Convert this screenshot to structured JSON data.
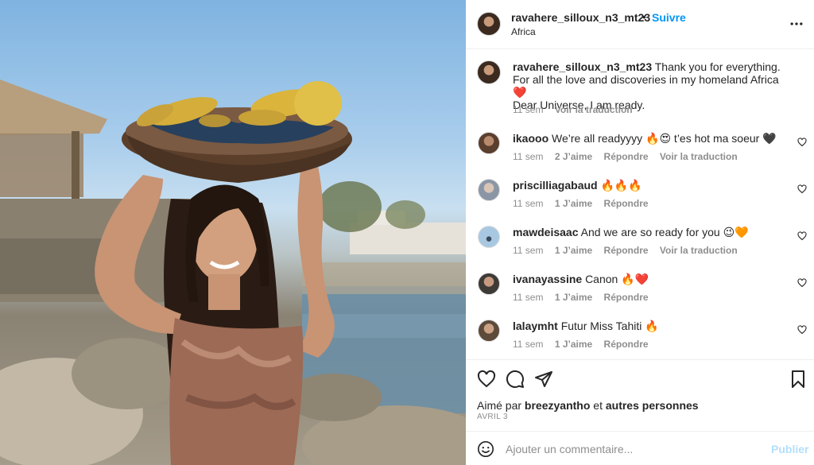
{
  "post": {
    "username": "ravahere_silloux_n3_mt23",
    "separator": "•",
    "follow_label": "Suivre",
    "location": "Africa",
    "more_icon": "more-horizontal-icon"
  },
  "caption": {
    "username": "ravahere_silloux_n3_mt23",
    "line1": "Thank you for everything.",
    "line2": "For all the love and discoveries in my homeland Africa ❤️",
    "line3": "Dear Universe, I am ready.",
    "time": "11 sem",
    "translate": "Voir la traduction"
  },
  "comments": [
    {
      "username": "ikaooo",
      "text": "We’re all readyyyy 🔥😍 t’es hot ma soeur 🖤",
      "time": "11 sem",
      "likes": "2 J’aime",
      "reply": "Répondre",
      "translate": "Voir la traduction"
    },
    {
      "username": "priscilliagabaud",
      "text": "🔥🔥🔥",
      "time": "11 sem",
      "likes": "1 J’aime",
      "reply": "Répondre",
      "translate": ""
    },
    {
      "username": "mawdeisaac",
      "text": "And we are so ready for you 😉🧡",
      "time": "11 sem",
      "likes": "1 J’aime",
      "reply": "Répondre",
      "translate": "Voir la traduction"
    },
    {
      "username": "ivanayassine",
      "text": "Canon 🔥❤️",
      "time": "11 sem",
      "likes": "1 J’aime",
      "reply": "Répondre",
      "translate": ""
    },
    {
      "username": "lalaymht",
      "text": "Futur Miss Tahiti 🔥",
      "time": "11 sem",
      "likes": "1 J’aime",
      "reply": "Répondre",
      "translate": ""
    }
  ],
  "actions": {
    "like_icon": "heart-icon",
    "comment_icon": "comment-icon",
    "share_icon": "send-icon",
    "save_icon": "bookmark-icon"
  },
  "likes": {
    "prefix": "Aimé par",
    "user": "breezyantho",
    "middle": "et",
    "suffix": "autres personnes"
  },
  "date": "AVRIL 3",
  "add_comment": {
    "placeholder": "Ajouter un commentaire...",
    "publish_label": "Publier",
    "emoji_icon": "emoji-icon"
  },
  "colors": {
    "link_blue": "#0095f6",
    "publish_disabled": "#b2dffc",
    "muted": "#8e8e8e",
    "text": "#262626"
  }
}
